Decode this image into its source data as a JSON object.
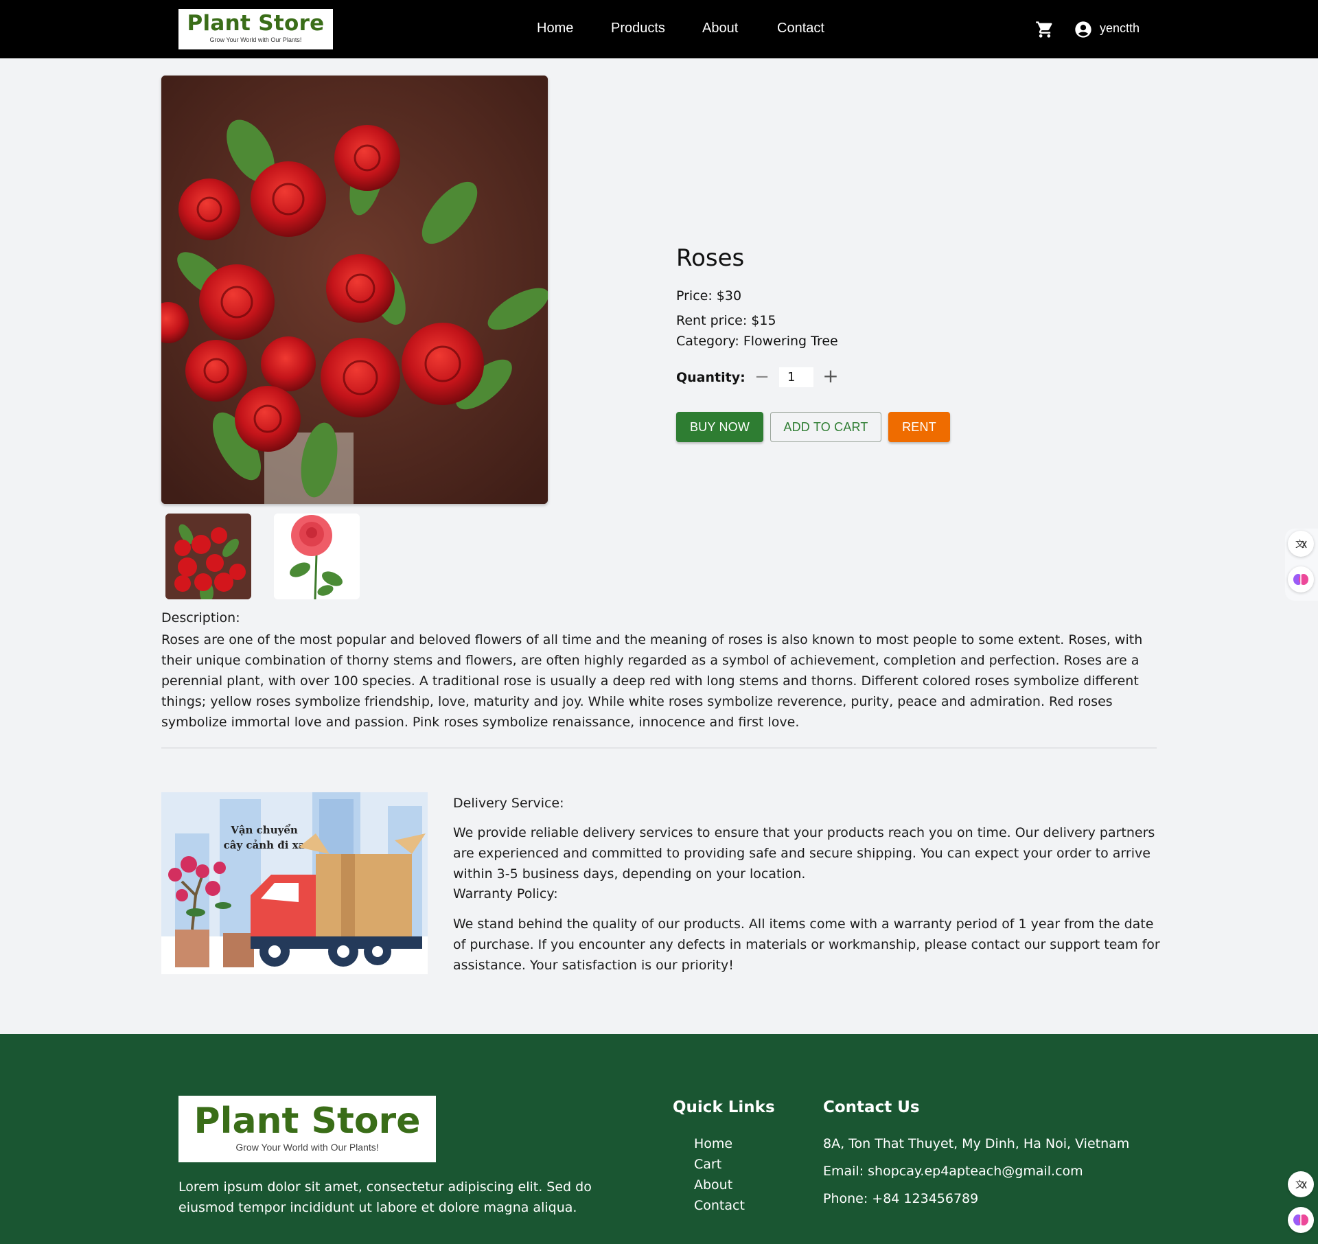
{
  "header": {
    "logo_title": "Plant Store",
    "logo_tagline": "Grow Your World with Our Plants!",
    "nav": [
      "Home",
      "Products",
      "About",
      "Contact"
    ],
    "username": "yenctth"
  },
  "product": {
    "name": "Roses",
    "price": "Price: $30",
    "rent_price": "Rent price: $15",
    "category": "Category: Flowering Tree",
    "quantity_label": "Quantity:",
    "quantity": "1",
    "buy_now": "BUY NOW",
    "add_to_cart": "ADD TO CART",
    "rent": "RENT",
    "description_label": "Description:",
    "description": "Roses are one of the most popular and beloved flowers of all time and the meaning of roses is also known to most people to some extent. Roses, with their unique combination of thorny stems and flowers, are often highly regarded as a symbol of achievement, completion and perfection. Roses are a perennial plant, with over 100 species. A traditional rose is usually a deep red with long stems and thorns. Different colored roses symbolize different things; yellow roses symbolize friendship, love, maturity and joy. While white roses symbolize reverence, purity, peace and admiration. Red roses symbolize immortal love and passion. Pink roses symbolize renaissance, innocence and first love."
  },
  "service": {
    "image_text_line1": "Vận chuyển",
    "image_text_line2": "cây cảnh đi xa",
    "delivery_label": "Delivery Service:",
    "delivery_text": "We provide reliable delivery services to ensure that your products reach you on time. Our delivery partners are experienced and committed to providing safe and secure shipping. You can expect your order to arrive within 3-5 business days, depending on your location.",
    "warranty_label": "Warranty Policy:",
    "warranty_text": "We stand behind the quality of our products. All items come with a warranty period of 1 year from the date of purchase. If you encounter any defects in materials or workmanship, please contact our support team for assistance. Your satisfaction is our priority!"
  },
  "footer": {
    "logo_title": "Plant Store",
    "logo_tagline": "Grow Your World with Our Plants!",
    "description": "Lorem ipsum dolor sit amet, consectetur adipiscing elit. Sed do eiusmod tempor incididunt ut labore et dolore magna aliqua.",
    "quick_links_title": "Quick Links",
    "quick_links": [
      "Home",
      "Cart",
      "About",
      "Contact"
    ],
    "contact_title": "Contact Us",
    "address": "8A, Ton That Thuyet, My Dinh, Ha Noi, Vietnam",
    "email": "Email: shopcay.ep4apteach@gmail.com",
    "phone": "Phone: +84 123456789"
  },
  "colors": {
    "header_bg": "#000000",
    "brand_green": "#3a6d18",
    "buy_button": "#2e7d32",
    "rent_button": "#ef6c00",
    "footer_bg": "#1a5632",
    "page_bg": "#f2f3f5"
  },
  "icons": [
    "cart-icon",
    "user-account-icon",
    "minus-icon",
    "plus-icon",
    "translate-icon",
    "brain-icon"
  ]
}
